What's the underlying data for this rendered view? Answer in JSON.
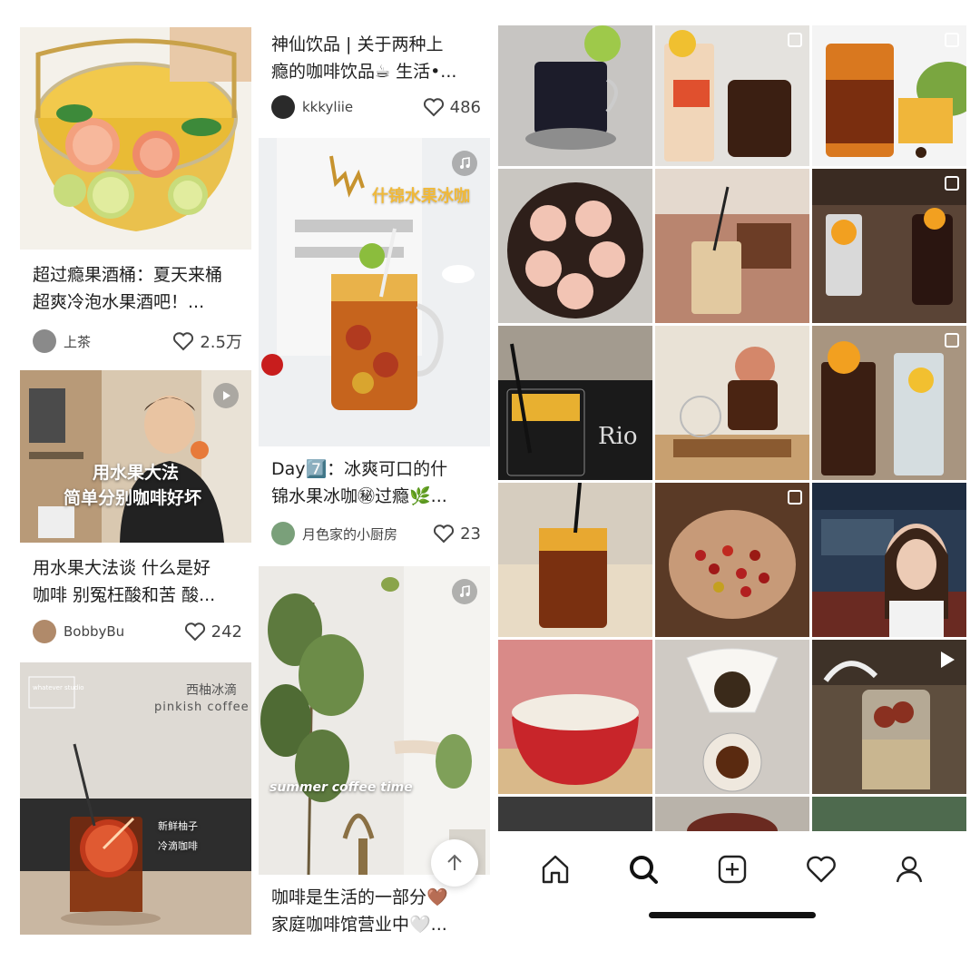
{
  "feed": {
    "cards": [
      {
        "id": "c1",
        "title_lines": [
          "超过瘾果酒桶：夏天来桶",
          "超爽冷泡水果酒吧！..."
        ],
        "author": "上茶",
        "likes": "2.5万"
      },
      {
        "id": "c2",
        "title_lines": [
          "用水果大法谈 什么是好",
          "咖啡 别冤枉酸和苦 酸..."
        ],
        "author": "BobbyBu",
        "likes": "242",
        "overlay_lines": [
          "用水果大法",
          "简单分别咖啡好坏"
        ]
      },
      {
        "id": "c3",
        "overlay_title": "西柚冰滴",
        "overlay_sub": "pinkish coffee",
        "overlay_brand": "whatever studio",
        "labels": [
          "新鲜柚子",
          "冷滴咖啡",
          "...",
          "..."
        ]
      },
      {
        "id": "c4",
        "title_lines": [
          "神仙饮品 | 关于两种上",
          "瘾的咖啡饮品☕ 生活•..."
        ],
        "author": "kkkyliie",
        "likes": "486"
      },
      {
        "id": "c5",
        "title_lines": [
          "Day7️⃣：冰爽可口的什",
          "锦水果冰咖㊙过瘾🌿..."
        ],
        "author": "月色家的小厨房",
        "likes": "23",
        "overlay_title": "什锦水果冰咖"
      },
      {
        "id": "c6",
        "title_lines": [
          "咖啡是生活的一部分🤎",
          "家庭咖啡馆营业中🤍..."
        ],
        "overlay_title": "summer coffee time"
      }
    ]
  },
  "icons": {
    "like": "heart-outline-icon",
    "video": "play-icon",
    "music": "music-note-icon",
    "scroll_top": "arrow-up-icon"
  },
  "tabbar": {
    "items": [
      "home-icon",
      "search-icon",
      "add-post-icon",
      "heart-icon",
      "profile-icon"
    ]
  }
}
